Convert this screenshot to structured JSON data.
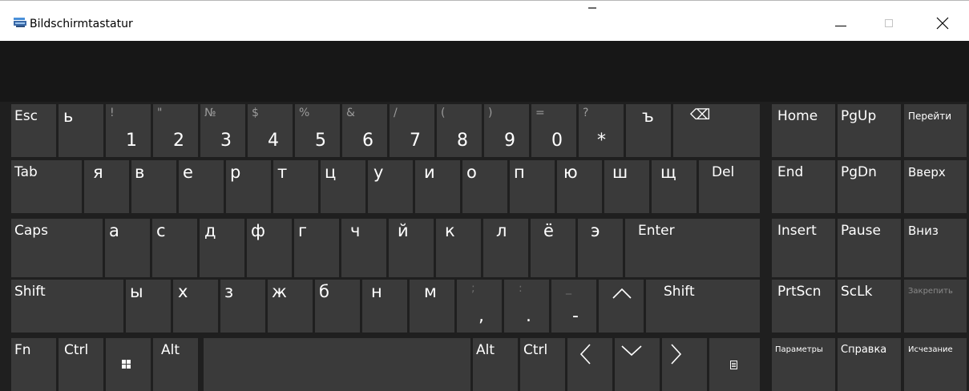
{
  "window": {
    "title": "Bildschirmtastatur",
    "controls": [
      "minimize",
      "maximize",
      "close"
    ]
  },
  "keys": {
    "row1": [
      {
        "id": "esc",
        "label": "Esc"
      },
      {
        "id": "soft-sign",
        "label": "ь"
      },
      {
        "id": "1",
        "top": "!",
        "main": "1"
      },
      {
        "id": "2",
        "top": "\"",
        "main": "2"
      },
      {
        "id": "3",
        "top": "№",
        "main": "3"
      },
      {
        "id": "4",
        "top": "$",
        "main": "4"
      },
      {
        "id": "5",
        "top": "%",
        "main": "5"
      },
      {
        "id": "6",
        "top": "&",
        "main": "6"
      },
      {
        "id": "7",
        "top": "/",
        "main": "7"
      },
      {
        "id": "8",
        "top": "(",
        "main": "8"
      },
      {
        "id": "9",
        "top": ")",
        "main": "9"
      },
      {
        "id": "0",
        "top": "=",
        "main": "0"
      },
      {
        "id": "asterisk",
        "top": "?",
        "main": "*"
      },
      {
        "id": "hard-sign",
        "label": "ъ"
      },
      {
        "id": "backspace",
        "label": "⌫"
      }
    ],
    "row2": [
      {
        "id": "tab",
        "label": "Tab"
      },
      {
        "id": "ya",
        "label": "я"
      },
      {
        "id": "ve",
        "label": "в"
      },
      {
        "id": "ie",
        "label": "е"
      },
      {
        "id": "er",
        "label": "р"
      },
      {
        "id": "te",
        "label": "т"
      },
      {
        "id": "tse",
        "label": "ц"
      },
      {
        "id": "u",
        "label": "у"
      },
      {
        "id": "i",
        "label": "и"
      },
      {
        "id": "o",
        "label": "о"
      },
      {
        "id": "pe",
        "label": "п"
      },
      {
        "id": "yu",
        "label": "ю"
      },
      {
        "id": "sha",
        "label": "ш"
      },
      {
        "id": "shcha",
        "label": "щ"
      },
      {
        "id": "del",
        "label": "Del"
      }
    ],
    "row3": [
      {
        "id": "caps",
        "label": "Caps"
      },
      {
        "id": "a",
        "label": "а"
      },
      {
        "id": "es",
        "label": "с"
      },
      {
        "id": "de",
        "label": "д"
      },
      {
        "id": "ef",
        "label": "ф"
      },
      {
        "id": "ge",
        "label": "г"
      },
      {
        "id": "che",
        "label": "ч"
      },
      {
        "id": "short-i",
        "label": "й"
      },
      {
        "id": "ka",
        "label": "к"
      },
      {
        "id": "el",
        "label": "л"
      },
      {
        "id": "yo",
        "label": "ё"
      },
      {
        "id": "e",
        "label": "э"
      },
      {
        "id": "enter",
        "label": "Enter"
      }
    ],
    "row4": [
      {
        "id": "shift-left",
        "label": "Shift"
      },
      {
        "id": "yery",
        "label": "ы"
      },
      {
        "id": "ha",
        "label": "х"
      },
      {
        "id": "ze",
        "label": "з"
      },
      {
        "id": "zhe",
        "label": "ж"
      },
      {
        "id": "be",
        "label": "б"
      },
      {
        "id": "en",
        "label": "н"
      },
      {
        "id": "em",
        "label": "м"
      },
      {
        "id": "comma",
        "top": ";",
        "main": ","
      },
      {
        "id": "period",
        "top": ":",
        "main": "."
      },
      {
        "id": "minus",
        "top": "_",
        "main": "-"
      },
      {
        "id": "up-arrow",
        "label": ""
      },
      {
        "id": "shift-right",
        "label": "Shift"
      }
    ],
    "row5": [
      {
        "id": "fn",
        "label": "Fn"
      },
      {
        "id": "ctrl-left",
        "label": "Ctrl"
      },
      {
        "id": "win",
        "label": ""
      },
      {
        "id": "alt-left",
        "label": "Alt"
      },
      {
        "id": "space",
        "label": ""
      },
      {
        "id": "alt-right",
        "label": "Alt"
      },
      {
        "id": "ctrl-right",
        "label": "Ctrl"
      },
      {
        "id": "left-arrow",
        "label": ""
      },
      {
        "id": "down-arrow",
        "label": ""
      },
      {
        "id": "right-arrow",
        "label": ""
      },
      {
        "id": "menu",
        "label": ""
      }
    ],
    "nav": [
      {
        "id": "home",
        "label": "Home"
      },
      {
        "id": "pgup",
        "label": "PgUp"
      },
      {
        "id": "goto",
        "label": "Перейти"
      },
      {
        "id": "end",
        "label": "End"
      },
      {
        "id": "pgdn",
        "label": "PgDn"
      },
      {
        "id": "vverh",
        "label": "Вверх"
      },
      {
        "id": "insert",
        "label": "Insert"
      },
      {
        "id": "pause",
        "label": "Pause"
      },
      {
        "id": "vniz",
        "label": "Вниз"
      },
      {
        "id": "prtscn",
        "label": "PrtScn"
      },
      {
        "id": "sclk",
        "label": "ScLk"
      },
      {
        "id": "pin",
        "label": "Закрепить"
      },
      {
        "id": "options",
        "label": "Параметры"
      },
      {
        "id": "help",
        "label": "Справка"
      },
      {
        "id": "fade",
        "label": "Исчезание"
      }
    ]
  },
  "colors": {
    "background": "#1f1f1f",
    "key": "#3a3a3a",
    "text": "#ffffff",
    "secondary_text": "#9b9b9b",
    "titlebar": "#ffffff"
  }
}
